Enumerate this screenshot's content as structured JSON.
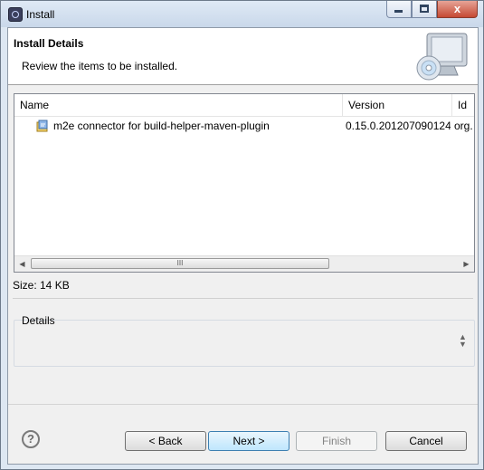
{
  "window": {
    "title": "Install",
    "close_symbol": "x"
  },
  "header": {
    "title": "Install Details",
    "description": "Review the items to be installed."
  },
  "table": {
    "columns": [
      "Name",
      "Version",
      "Id"
    ],
    "rows": [
      {
        "name": "m2e connector for build-helper-maven-plugin",
        "version": "0.15.0.201207090124",
        "id": "org."
      }
    ],
    "scroll_grip": "III"
  },
  "size_label": "Size: 14 KB",
  "details": {
    "label": "Details",
    "value": ""
  },
  "buttons": {
    "help": "?",
    "back": "< Back",
    "next": "Next >",
    "finish": "Finish",
    "cancel": "Cancel"
  },
  "colors": {
    "default_button": "#bee6fd",
    "close_button": "#c54a33"
  },
  "icons": [
    "app-icon",
    "monitor-cd-icon",
    "plugin-icon",
    "help-icon",
    "minimize-icon",
    "maximize-icon",
    "close-icon"
  ]
}
